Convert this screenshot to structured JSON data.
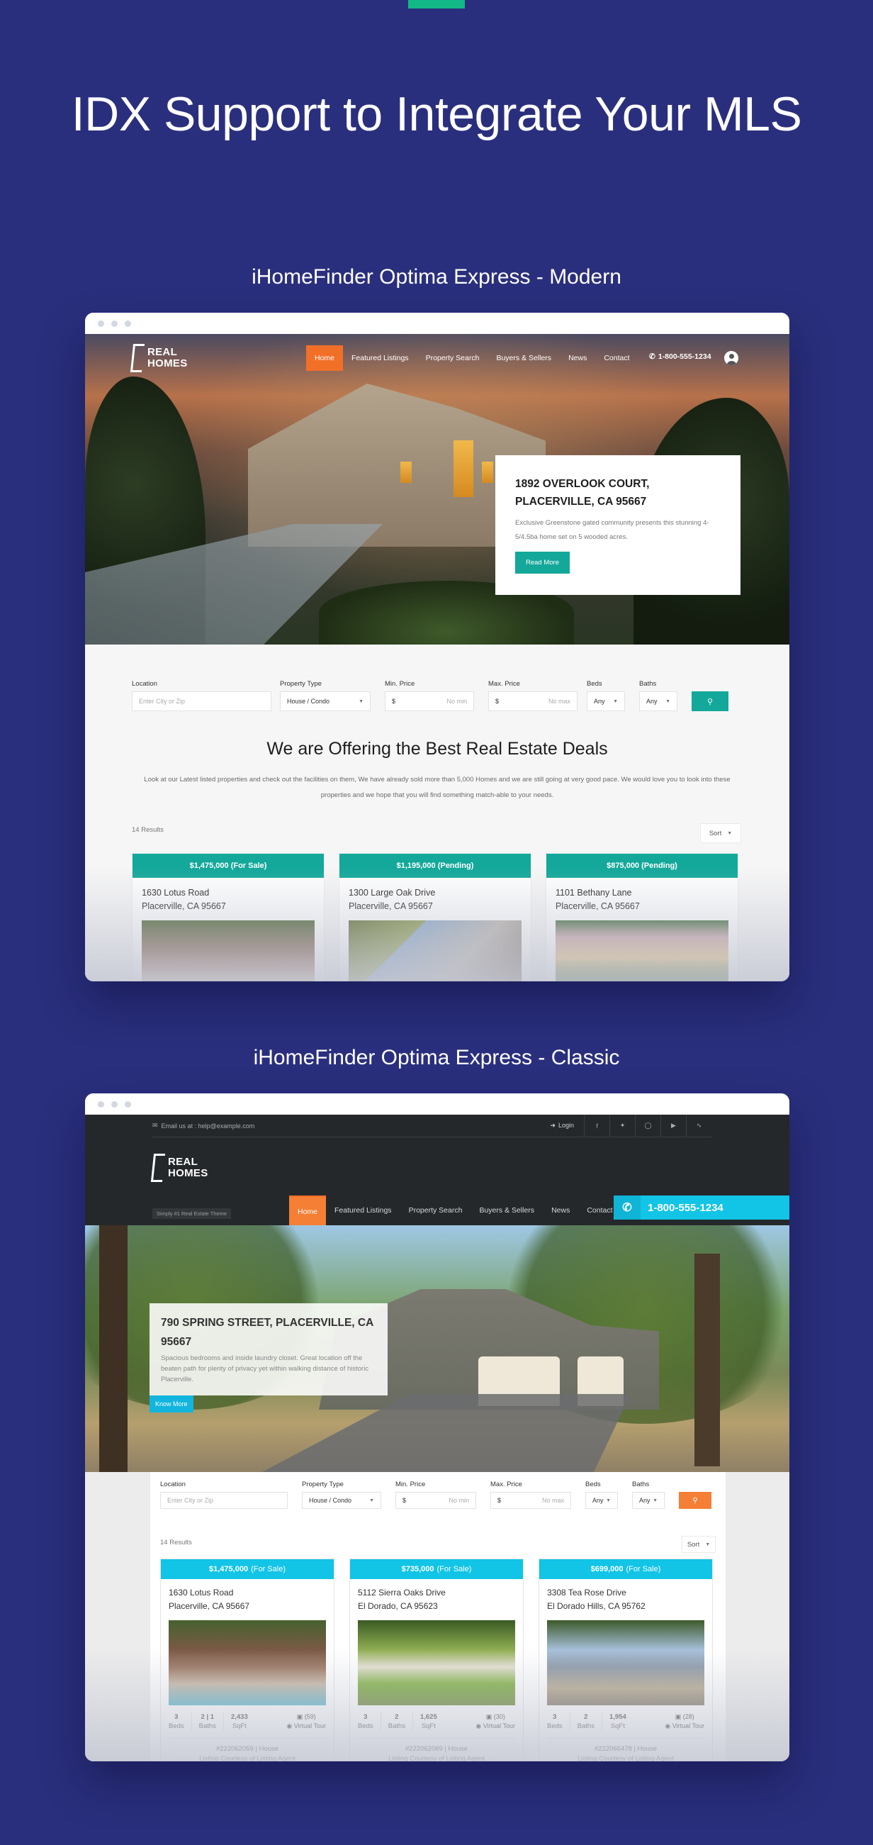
{
  "page": {
    "title": "IDX Support to Integrate Your MLS",
    "section_modern": "iHomeFinder Optima Express - Modern",
    "section_classic": "iHomeFinder Optima Express - Classic",
    "colors": {
      "background": "#2a2f7d",
      "accent_green": "#12b886"
    }
  },
  "modern": {
    "logo": {
      "line1": "REAL",
      "line2": "HOMES"
    },
    "nav": [
      "Home",
      "Featured Listings",
      "Property Search",
      "Buyers & Sellers",
      "News",
      "Contact"
    ],
    "active_nav": "Home",
    "phone": "1-800-555-1234",
    "icons": {
      "phone": "phone-icon",
      "user": "user-icon",
      "search": "search-icon"
    },
    "hero_card": {
      "title": "1892 OVERLOOK COURT, PLACERVILLE, CA 95667",
      "description": "Exclusive Greenstone gated community presents this stunning 4-5/4.5ba home set on 5 wooded acres.",
      "button": "Read More"
    },
    "search": {
      "location_label": "Location",
      "location_placeholder": "Enter City or Zip",
      "type_label": "Property Type",
      "type_value": "House / Condo",
      "min_label": "Min. Price",
      "min_prefix": "$",
      "min_placeholder": "No min",
      "max_label": "Max. Price",
      "max_prefix": "$",
      "max_placeholder": "No max",
      "beds_label": "Beds",
      "beds_value": "Any",
      "baths_label": "Baths",
      "baths_value": "Any"
    },
    "headline": "We are Offering the Best Real Estate Deals",
    "description": "Look at our Latest listed properties and check out the facilities on them, We have already sold more than 5,000 Homes and we are still going at very good pace. We would love you to look into these properties and we hope that you will find something match-able to your needs.",
    "results": "14 Results",
    "sort": "Sort",
    "colors": {
      "accent": "#13a89a",
      "nav_active": "#f26f28"
    },
    "listings": [
      {
        "price": "$1,475,000 (For Sale)",
        "street": "1630 Lotus Road",
        "city": "Placerville, CA 95667"
      },
      {
        "price": "$1,195,000 (Pending)",
        "street": "1300 Large Oak Drive",
        "city": "Placerville, CA 95667"
      },
      {
        "price": "$875,000 (Pending)",
        "street": "1101 Bethany Lane",
        "city": "Placerville, CA 95667"
      }
    ]
  },
  "classic": {
    "email": "Email us at : help@example.com",
    "login": "Login",
    "social": [
      "facebook",
      "twitter",
      "instagram",
      "youtube",
      "rss"
    ],
    "logo": {
      "line1": "REAL",
      "line2": "HOMES"
    },
    "tagline": "Simply #1 Real Estate Theme",
    "nav": [
      "Home",
      "Featured Listings",
      "Property Search",
      "Buyers & Sellers",
      "News",
      "Contact"
    ],
    "active_nav": "Home",
    "phone": "1-800-555-1234",
    "hero_card": {
      "title": "790 SPRING STREET, PLACERVILLE, CA 95667",
      "description": "Spacious bedrooms and inside laundry closet. Great location off the beaten path for plenty of privacy yet within walking distance of historic Placerville.",
      "button": "Know More"
    },
    "search": {
      "location_label": "Location",
      "location_placeholder": "Enter City or Zip",
      "type_label": "Property Type",
      "type_value": "House / Condo",
      "min_label": "Min. Price",
      "min_prefix": "$",
      "min_placeholder": "No min",
      "max_label": "Max. Price",
      "max_prefix": "$",
      "max_placeholder": "No max",
      "beds_label": "Beds",
      "beds_value": "Any",
      "baths_label": "Baths",
      "baths_value": "Any"
    },
    "results": "14 Results",
    "sort": "Sort",
    "colors": {
      "accent": "#12c4e6",
      "nav_active": "#f47f35"
    },
    "listings": [
      {
        "price": "$1,475,000",
        "status": "(For Sale)",
        "street": "1630 Lotus Road",
        "city": "Placerville, CA 95667",
        "beds": "3",
        "beds_label": "Beds",
        "baths": "2 | 1",
        "baths_label": "Baths",
        "sqft": "2,433",
        "sqft_label": "SqFt",
        "photos": "(59)",
        "tour": "Virtual Tour",
        "mls": "#222062059 | House",
        "courtesy": "Listing Courtesy of Listing Agent"
      },
      {
        "price": "$735,000",
        "status": "(For Sale)",
        "street": "5112 Sierra Oaks Drive",
        "city": "El Dorado, CA 95623",
        "beds": "3",
        "beds_label": "Beds",
        "baths": "2",
        "baths_label": "Baths",
        "sqft": "1,625",
        "sqft_label": "SqFt",
        "photos": "(30)",
        "tour": "Virtual Tour",
        "mls": "#222062069 | House",
        "courtesy": "Listing Courtesy of Listing Agent"
      },
      {
        "price": "$699,000",
        "status": "(For Sale)",
        "street": "3308 Tea Rose Drive",
        "city": "El Dorado Hills, CA 95762",
        "beds": "3",
        "beds_label": "Beds",
        "baths": "2",
        "baths_label": "Baths",
        "sqft": "1,954",
        "sqft_label": "SqFt",
        "photos": "(28)",
        "tour": "Virtual Tour",
        "mls": "#222066478 | House",
        "courtesy": "Listing Courtesy of Listing Agent"
      }
    ]
  }
}
